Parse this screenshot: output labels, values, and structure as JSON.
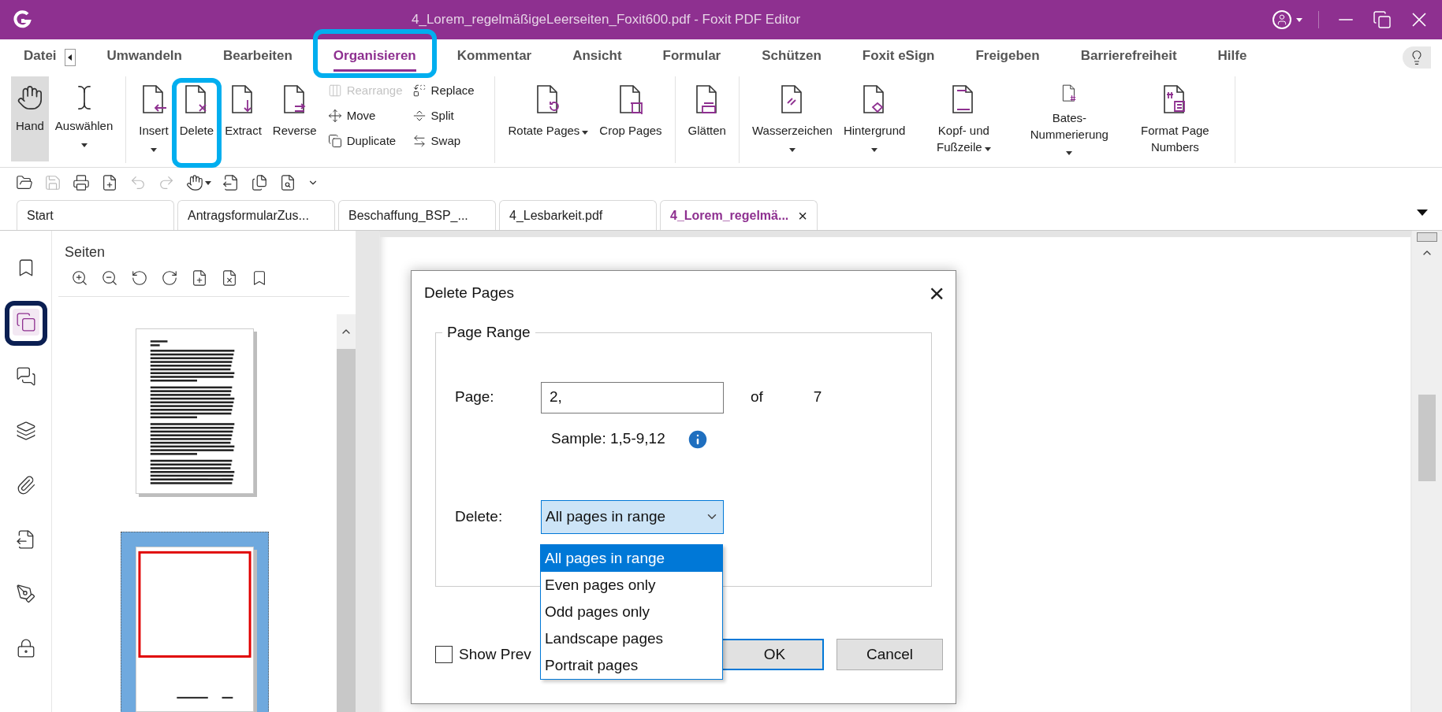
{
  "window": {
    "title": "4_Lorem_regelmäßigeLeerseiten_Foxit600.pdf - Foxit PDF Editor"
  },
  "menu_tabs": [
    {
      "label": "Datei",
      "selected": false
    },
    {
      "label": "Umwandeln",
      "selected": false
    },
    {
      "label": "Bearbeiten",
      "selected": false
    },
    {
      "label": "Organisieren",
      "selected": true,
      "highlighted": true
    },
    {
      "label": "Kommentar",
      "selected": false
    },
    {
      "label": "Ansicht",
      "selected": false
    },
    {
      "label": "Formular",
      "selected": false
    },
    {
      "label": "Schützen",
      "selected": false
    },
    {
      "label": "Foxit eSign",
      "selected": false
    },
    {
      "label": "Freigeben",
      "selected": false
    },
    {
      "label": "Barrierefreiheit",
      "selected": false
    },
    {
      "label": "Hilfe",
      "selected": false
    }
  ],
  "ribbon": {
    "groups": [
      [
        {
          "label": "Hand",
          "selected": true
        },
        {
          "label": "Auswählen",
          "selected": false,
          "dropdown": true,
          "dropdown_inline": false
        }
      ],
      [
        {
          "label": "Insert",
          "selected": false,
          "dropdown": true,
          "dropdown_inline": false
        },
        {
          "label": "Delete",
          "selected": false,
          "highlighted": true
        },
        {
          "label": "Extract",
          "selected": false
        },
        {
          "label": "Reverse",
          "selected": false
        }
      ],
      [
        {
          "label": "Rotate Pages",
          "selected": false,
          "dropdown": true,
          "dropdown_inline": true
        },
        {
          "label": "Crop Pages",
          "selected": false
        }
      ],
      [
        {
          "label": "Glätten",
          "selected": false
        }
      ],
      [
        {
          "label": "Wasserzeichen",
          "selected": false,
          "dropdown": true,
          "dropdown_inline": false
        },
        {
          "label": "Hintergrund",
          "selected": false,
          "dropdown": true,
          "dropdown_inline": false
        },
        {
          "label": "Kopf- und Fußzeile",
          "selected": false,
          "dropdown": true,
          "dropdown_inline": true
        },
        {
          "label": "Bates-Nummerierung",
          "selected": false,
          "dropdown": true,
          "dropdown_inline": false
        },
        {
          "label": "Format Page Numbers",
          "selected": false
        }
      ]
    ],
    "small_items": [
      {
        "label": "Rearrange",
        "disabled": true
      },
      {
        "label": "Move",
        "disabled": false
      },
      {
        "label": "Duplicate",
        "disabled": false
      },
      {
        "label": "Replace",
        "disabled": false
      },
      {
        "label": "Split",
        "disabled": false
      },
      {
        "label": "Swap",
        "disabled": false
      }
    ]
  },
  "quick_toolbar": [
    {
      "disabled": false
    },
    {
      "disabled": true
    },
    {
      "disabled": false
    },
    {
      "disabled": false
    },
    {
      "disabled": true
    },
    {
      "disabled": true
    },
    {
      "disabled": false
    },
    {
      "disabled": false
    },
    {
      "disabled": false
    },
    {
      "disabled": false
    }
  ],
  "doc_tabs": [
    {
      "label": "Start",
      "selected": false
    },
    {
      "label": "AntragsformularZus...",
      "selected": false
    },
    {
      "label": "Beschaffung_BSP_...",
      "selected": false
    },
    {
      "label": "4_Lesbarkeit.pdf",
      "selected": false
    },
    {
      "label": "4_Lorem_regelmä...",
      "selected": true,
      "close": "×"
    }
  ],
  "sidebar": {
    "items": [
      {
        "selected": false
      },
      {
        "selected": true,
        "highlighted": true
      },
      {
        "selected": false
      },
      {
        "selected": false
      },
      {
        "selected": false
      },
      {
        "selected": false
      },
      {
        "selected": false
      },
      {
        "selected": false
      }
    ]
  },
  "pages_panel": {
    "title": "Seiten",
    "thumbnails": [
      {
        "kind": "text",
        "selected": false
      },
      {
        "kind": "blank",
        "selected": true
      }
    ]
  },
  "dialog": {
    "title": "Delete Pages",
    "close": "×",
    "group": "Page Range",
    "page_label": "Page:",
    "page_value": "2,",
    "of_label": "of",
    "total": "7",
    "sample": "Sample: 1,5-9,12",
    "delete_label": "Delete:",
    "delete_value": "All pages in range",
    "options": [
      {
        "label": "All pages in range",
        "selected": true
      },
      {
        "label": "Even pages only",
        "selected": false
      },
      {
        "label": "Odd pages only",
        "selected": false
      },
      {
        "label": "Landscape pages",
        "selected": false
      },
      {
        "label": "Portrait pages",
        "selected": false
      }
    ],
    "show_preview": {
      "label": "Show Prev",
      "checked": false
    },
    "ok": "OK",
    "cancel": "Cancel"
  }
}
